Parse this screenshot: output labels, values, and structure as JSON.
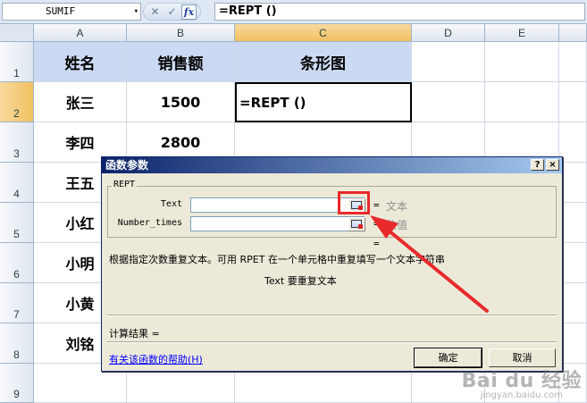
{
  "formula_bar": {
    "namebox": "SUMIF",
    "namebox_arrow": "▾",
    "cancel": "✕",
    "enter": "✓",
    "fx": "fx",
    "formula": "=REPT ()"
  },
  "sheet": {
    "columns": [
      "A",
      "B",
      "C",
      "D",
      "E"
    ],
    "rows": [
      "1",
      "2",
      "3",
      "4",
      "5",
      "6",
      "7",
      "8",
      "9"
    ],
    "header_row": [
      "姓名",
      "销售额",
      "条形图"
    ],
    "data": [
      {
        "name": "张三",
        "sales": "1500"
      },
      {
        "name": "李四",
        "sales": "2800"
      },
      {
        "name": "王五",
        "sales": ""
      },
      {
        "name": "小红",
        "sales": ""
      },
      {
        "name": "小明",
        "sales": ""
      },
      {
        "name": "小黄",
        "sales": ""
      },
      {
        "name": "刘铭",
        "sales": ""
      }
    ],
    "active_cell_value": "=REPT ()",
    "header_fill": "#ccd9f2"
  },
  "dialog": {
    "title": "函数参数",
    "help_button": "?",
    "close_button": "×",
    "function_name": "REPT",
    "args": [
      {
        "label": "Text",
        "value": "",
        "type": "文本"
      },
      {
        "label": "Number_times",
        "value": "",
        "type": "数值"
      }
    ],
    "equals": "=",
    "description": "根据指定次数重复文本。可用 RPET 在一个单元格中重复填写一个文本字符串",
    "arg_description": "Text  要重复文本",
    "result": "计算结果 =",
    "help_link": "有关该函数的帮助(H)",
    "ok": "确定",
    "cancel": "取消"
  },
  "annotation": {
    "color": "#e82a2a"
  },
  "watermark": {
    "main": "Bai du 经验",
    "sub": "jingyan.baidu.com"
  }
}
